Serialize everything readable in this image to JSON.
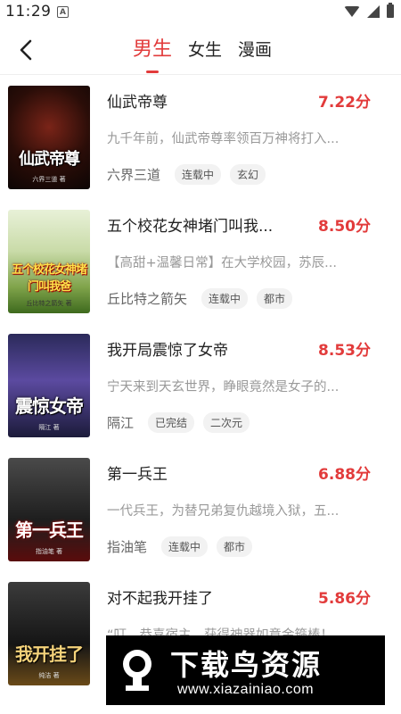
{
  "status_bar": {
    "time": "11:29",
    "notification_icon": "A"
  },
  "header": {
    "tabs": [
      {
        "label": "男生",
        "active": true
      },
      {
        "label": "女生",
        "active": false
      },
      {
        "label": "漫画",
        "active": false
      }
    ]
  },
  "books": [
    {
      "title": "仙武帝尊",
      "score": "7.22分",
      "description": "九千年前，仙武帝尊率领百万神将打入...",
      "author": "六界三道",
      "tags": [
        "连载中",
        "玄幻"
      ],
      "cover_text": "仙武帝尊",
      "cover_author": "六界三道 著"
    },
    {
      "title": "五个校花女神堵门叫我...",
      "score": "8.50分",
      "description": "【高甜+温馨日常】在大学校园，苏辰...",
      "author": "丘比特之箭矢",
      "tags": [
        "连载中",
        "都市"
      ],
      "cover_text": "五个校花女神堵门叫我爸",
      "cover_author": "丘比特之箭矢 著"
    },
    {
      "title": "我开局震惊了女帝",
      "score": "8.53分",
      "description": "宁天来到天玄世界，睁眼竟然是女子的...",
      "author": "隔江",
      "tags": [
        "已完结",
        "二次元"
      ],
      "cover_text": "震惊女帝",
      "cover_author": "隔江 著"
    },
    {
      "title": "第一兵王",
      "score": "6.88分",
      "description": "一代兵王，为替兄弟复仇越境入狱，五...",
      "author": "指油笔",
      "tags": [
        "连载中",
        "都市"
      ],
      "cover_text": "第一兵王",
      "cover_author": "指油笔 著"
    },
    {
      "title": "对不起我开挂了",
      "score": "5.86分",
      "description": "“叮，恭喜宿主，获得神器如意金箍棒！",
      "author": "",
      "tags": [],
      "cover_text": "我开挂了",
      "cover_author": "纯洁 著"
    }
  ],
  "watermark": {
    "title": "下载鸟资源",
    "url": "www.xiazainiao.com"
  },
  "colors": {
    "accent": "#e23b3b",
    "text_primary": "#222222",
    "text_secondary": "#999999",
    "tag_bg": "#f2f2f2"
  }
}
